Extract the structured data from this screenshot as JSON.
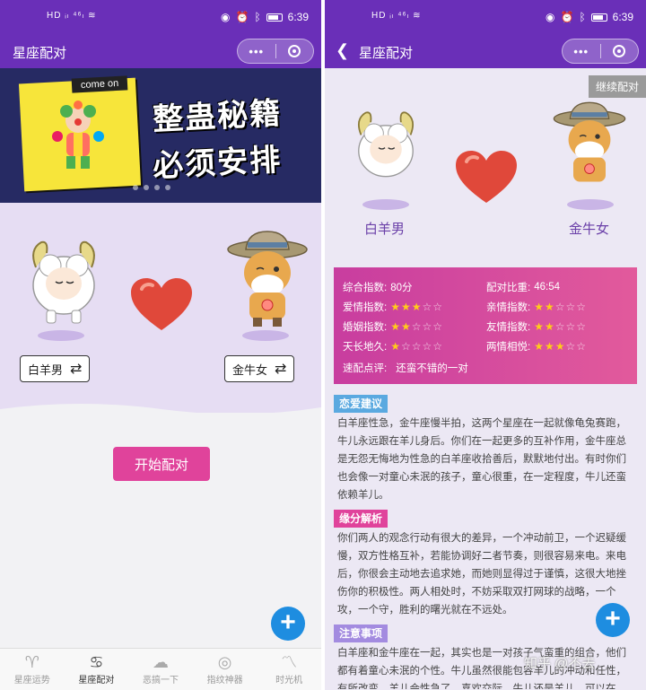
{
  "status": {
    "time_left": "6:39",
    "time_right": "6:39",
    "signal": "HD ᵢₗ ⁴⁶ₗ ≋"
  },
  "left": {
    "nav_title": "星座配对",
    "banner": {
      "tag": "come on",
      "slogan_line1": "整蛊秘籍",
      "slogan_line2": "必须安排"
    },
    "sign_male": "白羊男",
    "sign_female": "金牛女",
    "start_button": "开始配对",
    "fab": "+",
    "tabs": [
      {
        "label": "星座运势",
        "icon": "aries-icon",
        "glyph": "♈"
      },
      {
        "label": "星座配对",
        "icon": "cancer-icon",
        "glyph": "♋"
      },
      {
        "label": "恶搞一下",
        "icon": "cloud-icon",
        "glyph": "☁"
      },
      {
        "label": "指纹神器",
        "icon": "fingerprint-icon",
        "glyph": "◎"
      },
      {
        "label": "时光机",
        "icon": "chart-icon",
        "glyph": "〽"
      }
    ]
  },
  "right": {
    "nav_title": "星座配对",
    "continue_label": "继续配对",
    "sign_male": "白羊男",
    "sign_female": "金牛女",
    "scores": {
      "overall_label": "综合指数:",
      "overall_value": "80分",
      "ratio_label": "配对比重:",
      "ratio_value": "46:54",
      "love_label": "爱情指数:",
      "love_stars": 3,
      "family_label": "亲情指数:",
      "family_stars": 2,
      "marriage_label": "婚姻指数:",
      "marriage_stars": 2,
      "friend_label": "友情指数:",
      "friend_stars": 2,
      "forever_label": "天长地久:",
      "forever_stars": 1,
      "mutual_label": "两情相悦:",
      "mutual_stars": 3,
      "comment_label": "速配点评:",
      "comment_value": "还蛮不错的一对"
    },
    "sections": [
      {
        "title": "恋爱建议",
        "color": "#5aa9e0",
        "body": "白羊座性急，金牛座慢半拍，这两个星座在一起就像龟兔赛跑，牛儿永远跟在羊儿身后。你们在一起更多的互补作用，金牛座总是无怨无悔地为性急的白羊座收拾善后，默默地付出。有时你们也会像一对童心未泯的孩子，童心很重，在一定程度，牛儿还蛮依赖羊儿。"
      },
      {
        "title": "缘分解析",
        "color": "#e0439b",
        "body": "你们两人的观念行动有很大的差异，一个冲动前卫，一个迟疑缓慢，双方性格互补，若能协调好二者节奏，则很容易来电。来电后，你很会主动地去追求她，而她则显得过于谨慎，这很大地挫伤你的积极性。两人相处时，不妨采取双打网球的战略，一个攻，一个守，胜利的曙光就在不远处。"
      },
      {
        "title": "注意事项",
        "color": "#a38be0",
        "body": "白羊座和金牛座在一起，其实也是一对孩子气蛮重的组合，他们都有着童心未泯的个性。牛儿虽然很能包容羊儿的冲动和任性，有所改变，羊儿会性急了，喜欢交际，牛儿还是羊儿，可以在"
      }
    ],
    "fab": "+",
    "watermark": "知乎 @不去"
  },
  "colors": {
    "brand_purple": "#6a2fb8",
    "pink": "#e0439b",
    "fab_blue": "#1e8de0",
    "star": "#ffcc1a"
  }
}
